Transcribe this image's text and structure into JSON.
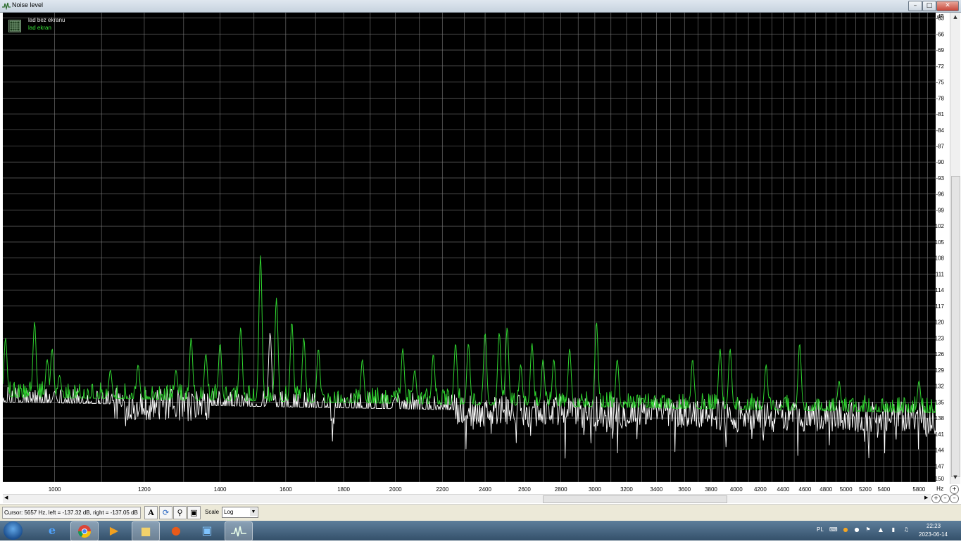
{
  "window": {
    "title": "Noise level",
    "minimize": "–",
    "maximize": "□",
    "close": "✕"
  },
  "legend": {
    "series_1": "lad bez ekranu",
    "series_2": "lad ekran"
  },
  "statusbar": {
    "cursor_readout": "Cursor:  5657 Hz,  left = -137.32 dB,  right = -137.05 dB",
    "scale_label": "Scale",
    "scale_value": "Log"
  },
  "taskbar": {
    "language": "PL",
    "time": "22:23",
    "date": "2023-06-14"
  },
  "icons": [
    "app-icon",
    "legend-grid-icon",
    "text-tool-icon",
    "refresh-icon",
    "zoom-tool-icon",
    "save-icon",
    "start-icon",
    "ie-icon",
    "chrome-icon",
    "media-player-icon",
    "explorer-icon",
    "app-orange-icon",
    "photo-icon",
    "noise-level-icon",
    "zoom-in-icon",
    "zoom-out-icon"
  ],
  "colors": {
    "plot_bg": "#000000",
    "grid": "#7c7c7c",
    "series_white": "#ffffff",
    "series_green": "#2fd32f"
  },
  "chart_data": {
    "type": "line",
    "title": "",
    "xlabel": "Hz",
    "ylabel": "dB",
    "x_scale": "log",
    "xlim": [
      900,
      6000
    ],
    "ylim": [
      -150,
      -62
    ],
    "grid": true,
    "legend_placement": "top-left",
    "x_ticks": [
      "1000",
      "1200",
      "1400",
      "1600",
      "1800",
      "2000",
      "2200",
      "2400",
      "2600",
      "2800",
      "3000",
      "3200",
      "3400",
      "3600",
      "3800",
      "4000",
      "4200",
      "4400",
      "4600",
      "4800",
      "5000",
      "5200",
      "5400",
      "5800"
    ],
    "y_ticks": [
      "-63",
      "-66",
      "-69",
      "-72",
      "-75",
      "-78",
      "-81",
      "-84",
      "-87",
      "-90",
      "-93",
      "-96",
      "-99",
      "-102",
      "-105",
      "-108",
      "-111",
      "-114",
      "-117",
      "-120",
      "-123",
      "-126",
      "-129",
      "-132",
      "-135",
      "-138",
      "-141",
      "-144",
      "-147",
      "-150"
    ],
    "series": [
      {
        "name": "lad bez ekranu",
        "color": "#ffffff",
        "noise_floor_db": -135,
        "peaks": [
          [
            1550,
            -122
          ],
          [
            1000,
            -133
          ],
          [
            2000,
            -134
          ]
        ]
      },
      {
        "name": "lad ekran",
        "color": "#2fd32f",
        "noise_floor_db": -134,
        "peaks": [
          [
            905,
            -123
          ],
          [
            960,
            -120
          ],
          [
            985,
            -127
          ],
          [
            995,
            -125
          ],
          [
            1010,
            -130
          ],
          [
            1120,
            -129
          ],
          [
            1185,
            -128
          ],
          [
            1280,
            -129
          ],
          [
            1320,
            -123
          ],
          [
            1360,
            -126
          ],
          [
            1400,
            -124
          ],
          [
            1460,
            -121
          ],
          [
            1520,
            -107.5
          ],
          [
            1570,
            -115.5
          ],
          [
            1620,
            -120
          ],
          [
            1660,
            -123
          ],
          [
            1710,
            -125
          ],
          [
            1870,
            -127
          ],
          [
            2030,
            -125
          ],
          [
            2080,
            -129
          ],
          [
            2160,
            -126
          ],
          [
            2260,
            -124
          ],
          [
            2320,
            -124
          ],
          [
            2400,
            -122
          ],
          [
            2470,
            -122
          ],
          [
            2510,
            -121
          ],
          [
            2580,
            -128
          ],
          [
            2640,
            -124
          ],
          [
            2700,
            -127
          ],
          [
            2760,
            -127
          ],
          [
            2850,
            -125
          ],
          [
            3010,
            -120
          ],
          [
            3140,
            -127
          ],
          [
            3660,
            -127
          ],
          [
            3870,
            -125
          ],
          [
            3950,
            -125
          ],
          [
            4250,
            -128
          ],
          [
            4550,
            -124
          ],
          [
            4930,
            -131
          ],
          [
            5800,
            -131
          ]
        ]
      }
    ]
  }
}
